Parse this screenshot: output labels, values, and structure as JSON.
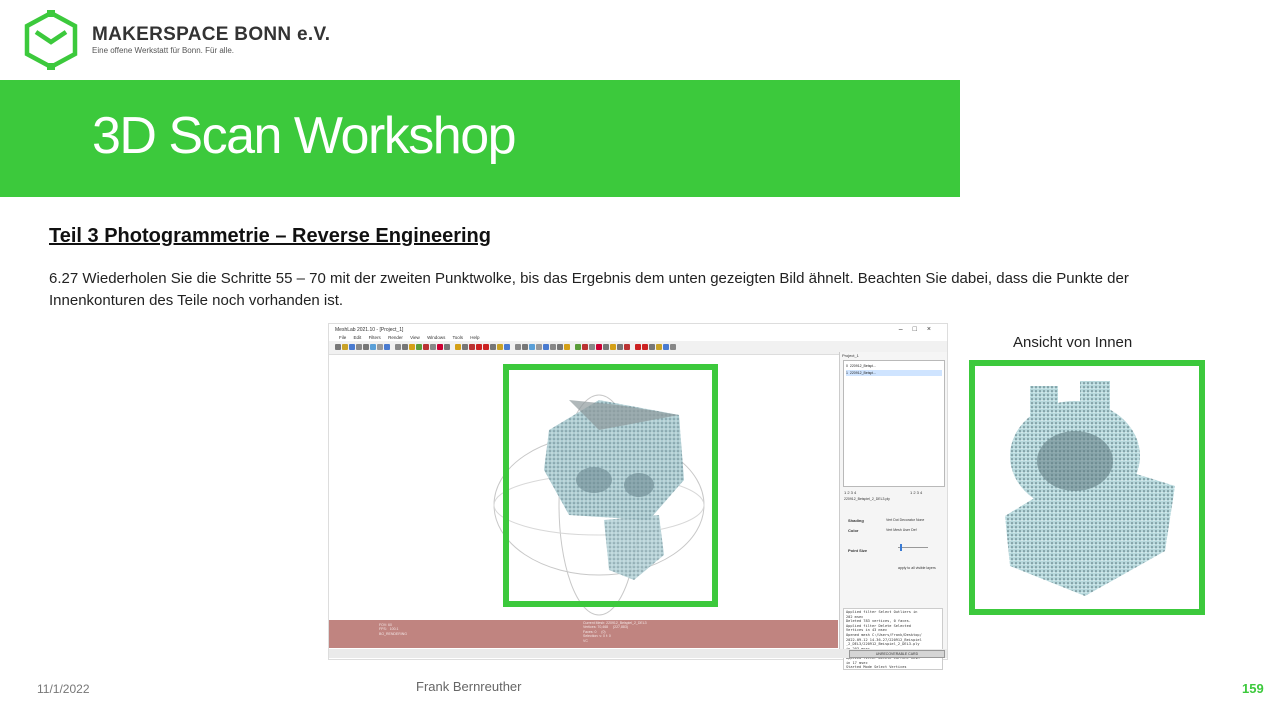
{
  "brand": {
    "name": "MAKERSPACE BONN e.V.",
    "tagline": "Eine offene Werkstatt für Bonn. Für alle.",
    "color": "#3cc93c"
  },
  "banner": {
    "title": "3D Scan Workshop"
  },
  "section": {
    "heading": "Teil 3  Photogrammetrie  – Reverse Engineering"
  },
  "instruction": "6.27 Wiederholen Sie die Schritte 55 – 70 mit der zweiten Punktwolke, bis das Ergebnis dem unten gezeigten Bild ähnelt. Beachten Sie dabei, dass die Punkte der Innenkonturen des Teile noch vorhanden ist.",
  "screenshot": {
    "window_title": "MeshLab 2021.10 - [Project_1]",
    "menu": [
      "File",
      "Edit",
      "Filters",
      "Render",
      "View",
      "Windows",
      "Tools",
      "Help"
    ],
    "panel_title": "Project_1",
    "layers": [
      {
        "index": "0",
        "name": "220912_Beispi..."
      },
      {
        "index": "1",
        "name": "220912_Beispi..."
      }
    ],
    "tab_numbers_left": "1  2  3  4",
    "tab_numbers_right": "1  2  3  4",
    "layer_file": "220912_Beispiel_2_DEL3.ply",
    "props": {
      "shading_label": "Shading",
      "shading_options": "Vert   Dot Decorator   None",
      "color_label": "Color",
      "color_options": "Vert   Mesh   User Def",
      "point_size_label": "Point Size",
      "apply_all": "apply to all visible layers"
    },
    "log": "Applied filter Select Outliers in\n202 msec\nDeleted 783 vertices, 0 faces.\nApplied filter Delete Selected\nVertices in 43 msec\nOpened mesh C:/Users/Frank/Desktop/\n2022-09-12 14-36-27/220912_Beispiel\n_2_DEL3/220912_Beispiel_2_DEL3.ply\nin 203 msec\nAll files opened in 213 msec\nApplied filter Delete Current Mesh\nin 17 msec\nStarted Mode Select Vertices",
    "status_left": "FOV: 60\nFPS:   100.1\nBO_RENDERING",
    "status_mid": "Current Mesh: 220912_Beispiel_2_DEL3\nVertices: 70,468     (227,883)\nFaces: 0     (0)\nSelection: v: 0 f: 0\nVC",
    "status_button": "UNRECOVERABLE CARD"
  },
  "inner_caption": "Ansicht von Innen",
  "footer": {
    "date": "11/1/2022",
    "author": "Frank Bernreuther",
    "page": "159"
  }
}
